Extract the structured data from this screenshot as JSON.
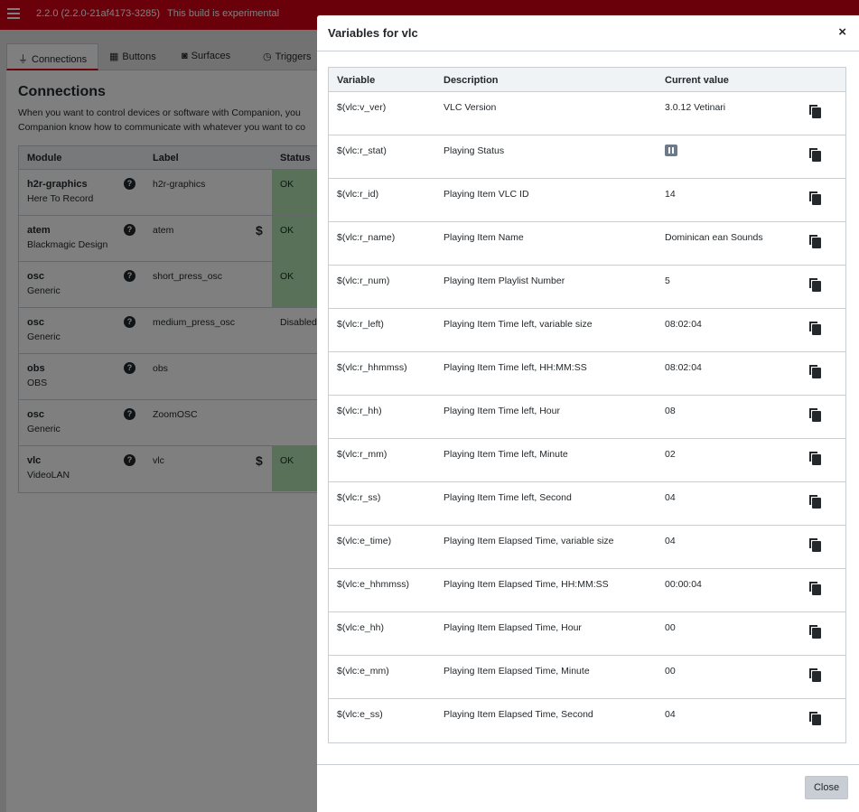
{
  "header": {
    "version": "2.2.0 (2.2.0-21af4173-3285)",
    "build_note": "This build is experimental"
  },
  "tabs": [
    {
      "label": "Connections",
      "icon": "plug-icon",
      "active": true
    },
    {
      "label": "Buttons",
      "icon": "calendar-grid-icon"
    },
    {
      "label": "Surfaces",
      "icon": "gamepad-icon"
    },
    {
      "label": "Triggers",
      "icon": "clock-icon"
    }
  ],
  "connections": {
    "title": "Connections",
    "desc_line1": "When you want to control devices or software with Companion, you",
    "desc_line2": "Companion know how to communicate with whatever you want to co",
    "columns": {
      "module": "Module",
      "label": "Label",
      "status": "Status"
    },
    "rows": [
      {
        "module": "h2r-graphics",
        "vendor": "Here To Record",
        "label": "h2r-graphics",
        "status": "OK"
      },
      {
        "module": "atem",
        "vendor": "Blackmagic Design",
        "label": "atem",
        "status": "OK"
      },
      {
        "module": "osc",
        "vendor": "Generic",
        "label": "short_press_osc",
        "status": "OK"
      },
      {
        "module": "osc",
        "vendor": "Generic",
        "label": "medium_press_osc",
        "status": "Disabled"
      },
      {
        "module": "obs",
        "vendor": "OBS",
        "label": "obs",
        "status": ""
      },
      {
        "module": "osc",
        "vendor": "Generic",
        "label": "ZoomOSC",
        "status": ""
      },
      {
        "module": "vlc",
        "vendor": "VideoLAN",
        "label": "vlc",
        "status": "OK"
      }
    ]
  },
  "modal": {
    "title": "Variables for vlc",
    "close_x": "×",
    "close_button": "Close",
    "columns": {
      "variable": "Variable",
      "description": "Description",
      "value": "Current value"
    },
    "rows": [
      {
        "variable": "$(vlc:v_ver)",
        "description": "VLC Version",
        "value": "3.0.12 Vetinari"
      },
      {
        "variable": "$(vlc:r_stat)",
        "description": "Playing Status",
        "value": ""
      },
      {
        "variable": "$(vlc:r_id)",
        "description": "Playing Item VLC ID",
        "value": "14"
      },
      {
        "variable": "$(vlc:r_name)",
        "description": "Playing Item Name",
        "value": "Dominican ean Sounds"
      },
      {
        "variable": "$(vlc:r_num)",
        "description": "Playing Item Playlist Number",
        "value": "5"
      },
      {
        "variable": "$(vlc:r_left)",
        "description": "Playing Item Time left, variable size",
        "value": "08:02:04"
      },
      {
        "variable": "$(vlc:r_hhmmss)",
        "description": "Playing Item Time left, HH:MM:SS",
        "value": "08:02:04"
      },
      {
        "variable": "$(vlc:r_hh)",
        "description": "Playing Item Time left, Hour",
        "value": "08"
      },
      {
        "variable": "$(vlc:r_mm)",
        "description": "Playing Item Time left, Minute",
        "value": "02"
      },
      {
        "variable": "$(vlc:r_ss)",
        "description": "Playing Item Time left, Second",
        "value": "04"
      },
      {
        "variable": "$(vlc:e_time)",
        "description": "Playing Item Elapsed Time, variable size",
        "value": "04"
      },
      {
        "variable": "$(vlc:e_hhmmss)",
        "description": "Playing Item Elapsed Time, HH:MM:SS",
        "value": "00:00:04"
      },
      {
        "variable": "$(vlc:e_hh)",
        "description": "Playing Item Elapsed Time, Hour",
        "value": "00"
      },
      {
        "variable": "$(vlc:e_mm)",
        "description": "Playing Item Elapsed Time, Minute",
        "value": "00"
      },
      {
        "variable": "$(vlc:e_ss)",
        "description": "Playing Item Elapsed Time, Second",
        "value": "04"
      }
    ]
  },
  "colors": {
    "brand_red": "#d50215",
    "status_ok": "#b3e2b3"
  }
}
